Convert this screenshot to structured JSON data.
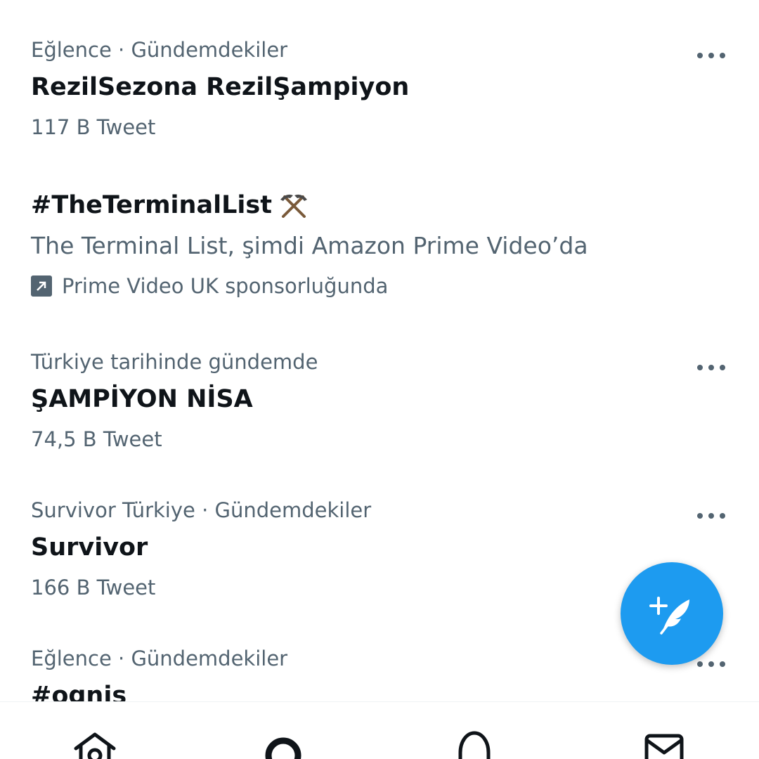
{
  "trends": [
    {
      "context": "Eğlence · Gündemdekiler",
      "title": "RezilSezona RezilŞampiyon",
      "count": "117 B Tweet"
    },
    {
      "context": "Türkiye tarihinde gündemde",
      "title": "ŞAMPİYON NİSA",
      "count": "74,5 B Tweet"
    },
    {
      "context": "Survivor Türkiye · Gündemdekiler",
      "title": "Survivor",
      "count": "166 B Tweet"
    },
    {
      "context": "Eğlence · Gündemdekiler",
      "title": "#ognis"
    }
  ],
  "promoted": {
    "title": "#TheTerminalList",
    "title_emoji_icon": "crossed-pickaxes-icon",
    "description": "The Terminal List, şimdi Amazon Prime Video’da",
    "sponsor": "Prime Video UK sponsorluğunda"
  },
  "fab": {
    "icon": "compose-tweet-icon",
    "color": "#1d9bf0"
  },
  "bottom_nav": {
    "items": [
      "home-icon",
      "search-icon",
      "notifications-icon",
      "messages-icon"
    ]
  },
  "colors": {
    "accent": "#1d9bf0",
    "text_primary": "#0f1419",
    "text_secondary": "#536471"
  }
}
